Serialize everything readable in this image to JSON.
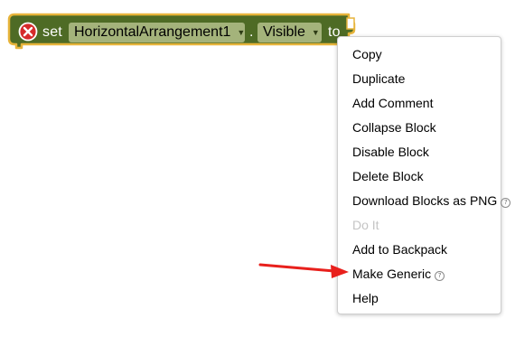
{
  "block": {
    "set_label": "set",
    "component_dropdown": "HorizontalArrangement1",
    "dot_label": ".",
    "property_dropdown": "Visible",
    "to_label": "to",
    "error_icon": "error-x-icon",
    "colors": {
      "block_fill": "#4e6b25",
      "block_border": "#e7b43b",
      "dropdown_fill": "#a4b37b",
      "error_red": "#d62b2b"
    }
  },
  "context_menu": {
    "items": [
      {
        "label": "Copy",
        "disabled": false,
        "has_help": false
      },
      {
        "label": "Duplicate",
        "disabled": false,
        "has_help": false
      },
      {
        "label": "Add Comment",
        "disabled": false,
        "has_help": false
      },
      {
        "label": "Collapse Block",
        "disabled": false,
        "has_help": false
      },
      {
        "label": "Disable Block",
        "disabled": false,
        "has_help": false
      },
      {
        "label": "Delete Block",
        "disabled": false,
        "has_help": false
      },
      {
        "label": "Download Blocks as PNG",
        "disabled": false,
        "has_help": true
      },
      {
        "label": "Do It",
        "disabled": true,
        "has_help": false
      },
      {
        "label": "Add to Backpack",
        "disabled": false,
        "has_help": false
      },
      {
        "label": "Make Generic",
        "disabled": false,
        "has_help": true
      },
      {
        "label": "Help",
        "disabled": false,
        "has_help": false
      }
    ],
    "help_glyph": "?"
  },
  "annotation": {
    "arrow_color": "#e8201c",
    "points_to": "Make Generic"
  }
}
